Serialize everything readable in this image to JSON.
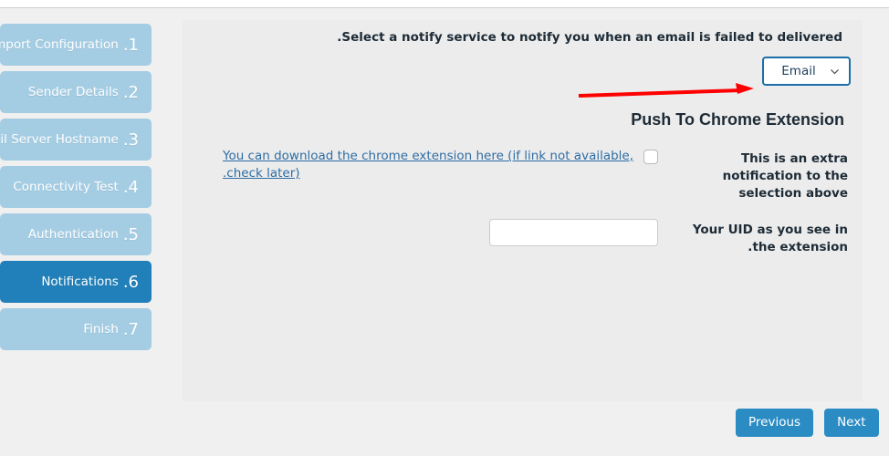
{
  "wizard": {
    "steps": [
      {
        "num": "1.",
        "label": "Import Configuration",
        "active": false
      },
      {
        "num": "2.",
        "label": "Sender Details",
        "active": false
      },
      {
        "num": "3.",
        "label": "Mail Server Hostname",
        "active": false
      },
      {
        "num": "4.",
        "label": "Connectivity Test",
        "active": false
      },
      {
        "num": "5.",
        "label": "Authentication",
        "active": false
      },
      {
        "num": "6.",
        "label": "Notifications",
        "active": true
      },
      {
        "num": "7.",
        "label": "Finish",
        "active": false
      }
    ]
  },
  "main": {
    "intro": "Select a notify service to notify you when an email is failed to delivered.",
    "notify_select": {
      "value": "Email",
      "icon": "chevron-down-icon"
    },
    "section_heading": "Push To Chrome Extension",
    "extra_notification": {
      "label": "This is an extra notification to the selection above",
      "link_text": "You can download the chrome extension here (if link not available, check later).",
      "checked": false
    },
    "uid": {
      "label": "Your UID as you see in the extension.",
      "value": "",
      "placeholder": ""
    }
  },
  "footer": {
    "previous_label": "Previous",
    "next_label": "Next"
  },
  "colors": {
    "accent": "#2b8cc4",
    "active_step": "#2180b9",
    "inactive_step": "#a4cde4",
    "link": "#2e6da4",
    "arrow": "#ff0000",
    "panel_bg": "#ececec",
    "page_bg": "#f0f0f0"
  }
}
